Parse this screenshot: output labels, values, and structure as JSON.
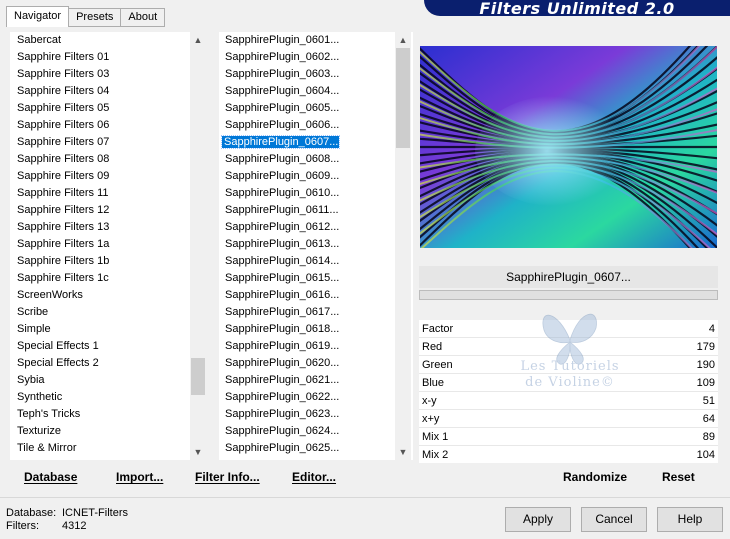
{
  "banner": {
    "title": "Filters Unlimited 2.0"
  },
  "tabs": [
    {
      "label": "Navigator",
      "active": true
    },
    {
      "label": "Presets",
      "active": false
    },
    {
      "label": "About",
      "active": false
    }
  ],
  "categories": {
    "items": [
      "Sabercat",
      "Sapphire Filters 01",
      "Sapphire Filters 03",
      "Sapphire Filters 04",
      "Sapphire Filters 05",
      "Sapphire Filters 06",
      "Sapphire Filters 07",
      "Sapphire Filters 08",
      "Sapphire Filters 09",
      "Sapphire Filters 11",
      "Sapphire Filters 12",
      "Sapphire Filters 13",
      "Sapphire Filters 1a",
      "Sapphire Filters 1b",
      "Sapphire Filters 1c",
      "ScreenWorks",
      "Scribe",
      "Simple",
      "Special Effects 1",
      "Special Effects 2",
      "Sybia",
      "Synthetic",
      "Teph's Tricks",
      "Texturize",
      "Tile & Mirror"
    ],
    "highlighted": "Sapphire Filters 07"
  },
  "filters": {
    "items": [
      "SapphirePlugin_0601...",
      "SapphirePlugin_0602...",
      "SapphirePlugin_0603...",
      "SapphirePlugin_0604...",
      "SapphirePlugin_0605...",
      "SapphirePlugin_0606...",
      "SapphirePlugin_0607...",
      "SapphirePlugin_0608...",
      "SapphirePlugin_0609...",
      "SapphirePlugin_0610...",
      "SapphirePlugin_0611...",
      "SapphirePlugin_0612...",
      "SapphirePlugin_0613...",
      "SapphirePlugin_0614...",
      "SapphirePlugin_0615...",
      "SapphirePlugin_0616...",
      "SapphirePlugin_0617...",
      "SapphirePlugin_0618...",
      "SapphirePlugin_0619...",
      "SapphirePlugin_0620...",
      "SapphirePlugin_0621...",
      "SapphirePlugin_0622...",
      "SapphirePlugin_0623...",
      "SapphirePlugin_0624...",
      "SapphirePlugin_0625..."
    ],
    "selected": "SapphirePlugin_0607..."
  },
  "left_buttons": {
    "database": "Database",
    "import": "Import...",
    "filter_info": "Filter Info...",
    "editor": "Editor..."
  },
  "right_buttons": {
    "randomize": "Randomize",
    "reset": "Reset"
  },
  "current_filter": {
    "name": "SapphirePlugin_0607..."
  },
  "params": [
    {
      "label": "Factor",
      "value": "4"
    },
    {
      "label": "Red",
      "value": "179"
    },
    {
      "label": "Green",
      "value": "190"
    },
    {
      "label": "Blue",
      "value": "109"
    },
    {
      "label": "x-y",
      "value": "51"
    },
    {
      "label": "x+y",
      "value": "64"
    },
    {
      "label": "Mix 1",
      "value": "89"
    },
    {
      "label": "Mix 2",
      "value": "104"
    }
  ],
  "watermark": {
    "line1": "Les Tutoriels",
    "line2": "de Violine©"
  },
  "status": {
    "database_label": "Database:",
    "database_value": "ICNET-Filters",
    "filters_label": "Filters:",
    "filters_value": "4312"
  },
  "dialog": {
    "apply": "Apply",
    "cancel": "Cancel",
    "help": "Help"
  },
  "colors": {
    "selection": "#0078d7",
    "banner": "#0a1f6e"
  }
}
